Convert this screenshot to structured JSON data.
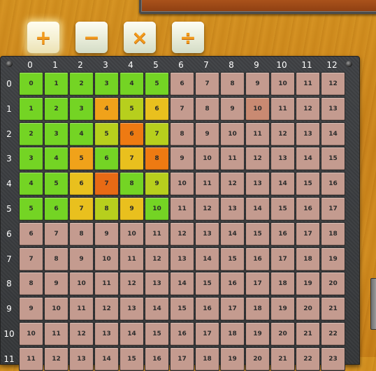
{
  "operators": [
    {
      "name": "add",
      "symbol": "+",
      "active": true
    },
    {
      "name": "subtract",
      "symbol": "−",
      "active": false
    },
    {
      "name": "multiply",
      "symbol": "×",
      "active": false
    },
    {
      "name": "divide",
      "symbol": "÷",
      "active": false
    }
  ],
  "columns": [
    "0",
    "1",
    "2",
    "3",
    "4",
    "5",
    "6",
    "7",
    "8",
    "9",
    "10",
    "11",
    "12"
  ],
  "rows": [
    "0",
    "1",
    "2",
    "3",
    "4",
    "5",
    "6",
    "7",
    "8",
    "9",
    "10",
    "11"
  ],
  "visible_rows": 11,
  "colors": {
    "default": "#c49b8f",
    "hover_cell": "#c98a72",
    "green": "#74d424",
    "yellow_green": "#b7cf1d",
    "yellow": "#e9c01e",
    "amber": "#f0a21a",
    "orange": "#ee7a12",
    "red_orange": "#e76a15"
  },
  "colored_cells": {
    "0,0": "green",
    "0,1": "green",
    "0,2": "green",
    "0,3": "green",
    "0,4": "green",
    "0,5": "green",
    "1,0": "green",
    "1,1": "green",
    "1,2": "green",
    "1,3": "amber",
    "1,4": "yellow_green",
    "1,5": "yellow",
    "2,0": "green",
    "2,1": "green",
    "2,2": "green",
    "2,3": "yellow_green",
    "2,4": "orange",
    "2,5": "yellow_green",
    "3,0": "green",
    "3,1": "green",
    "3,2": "amber",
    "3,3": "green",
    "3,4": "yellow",
    "3,5": "orange",
    "4,0": "green",
    "4,1": "green",
    "4,2": "yellow",
    "4,3": "red_orange",
    "4,4": "green",
    "4,5": "yellow_green",
    "5,0": "green",
    "5,1": "green",
    "5,2": "yellow",
    "5,3": "yellow_green",
    "5,4": "yellow",
    "5,5": "green",
    "1,9": "hover_cell"
  }
}
